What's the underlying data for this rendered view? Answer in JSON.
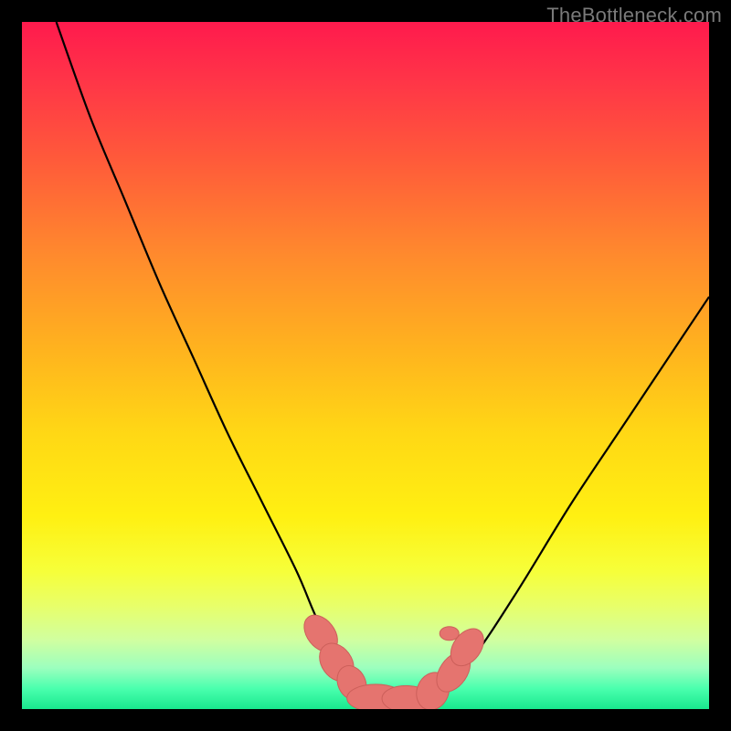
{
  "watermark": "TheBottleneck.com",
  "chart_data": {
    "type": "line",
    "title": "",
    "xlabel": "",
    "ylabel": "",
    "xlim": [
      0,
      100
    ],
    "ylim": [
      0,
      100
    ],
    "grid": false,
    "legend": false,
    "axes_visible": false,
    "background_gradient": [
      "#ff1a4d",
      "#ffb41e",
      "#fff012",
      "#19e88e"
    ],
    "series": [
      {
        "name": "bottleneck-curve",
        "x": [
          5,
          10,
          15,
          20,
          25,
          30,
          35,
          40,
          43,
          46,
          48,
          50,
          52,
          54,
          56,
          58,
          60,
          62,
          66,
          72,
          80,
          88,
          96,
          100
        ],
        "y": [
          100,
          86,
          74,
          62,
          51,
          40,
          30,
          20,
          13,
          8,
          4.5,
          2.5,
          1.5,
          1.2,
          1.2,
          1.5,
          2.5,
          4,
          8,
          17,
          30,
          42,
          54,
          60
        ]
      }
    ],
    "markers": [
      {
        "x": 43.5,
        "y": 11.0,
        "rx": 2.0,
        "ry": 3.0,
        "rot": -38
      },
      {
        "x": 45.8,
        "y": 6.8,
        "rx": 2.2,
        "ry": 3.0,
        "rot": -35
      },
      {
        "x": 48.0,
        "y": 3.8,
        "rx": 2.0,
        "ry": 2.6,
        "rot": -25
      },
      {
        "x": 51.5,
        "y": 1.6,
        "rx": 4.2,
        "ry": 2.0,
        "rot": 0
      },
      {
        "x": 56.2,
        "y": 1.4,
        "rx": 3.8,
        "ry": 2.0,
        "rot": 3
      },
      {
        "x": 59.8,
        "y": 2.6,
        "rx": 2.3,
        "ry": 2.8,
        "rot": 22
      },
      {
        "x": 62.8,
        "y": 5.4,
        "rx": 2.0,
        "ry": 3.2,
        "rot": 34
      },
      {
        "x": 64.8,
        "y": 9.0,
        "rx": 2.0,
        "ry": 3.0,
        "rot": 36
      },
      {
        "x": 62.2,
        "y": 11.0,
        "rx": 1.4,
        "ry": 1.0,
        "rot": 0
      }
    ]
  }
}
